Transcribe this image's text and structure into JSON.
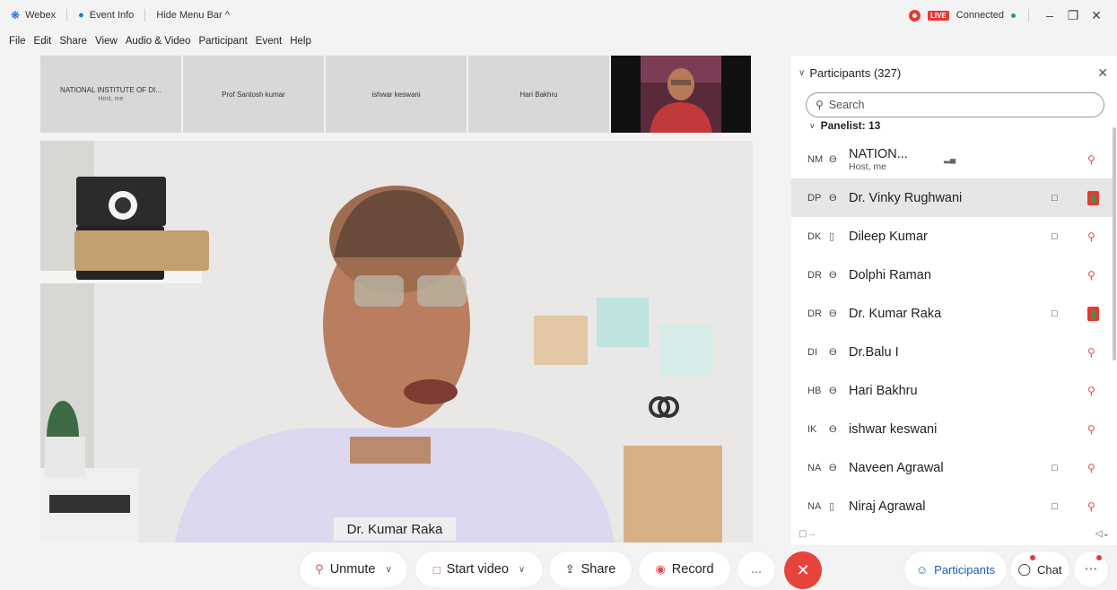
{
  "titlebar": {
    "app": "Webex",
    "event_info": "Event Info",
    "hide_menu": "Hide Menu Bar ^",
    "live": "LIVE",
    "connected": "Connected"
  },
  "menu": [
    "File",
    "Edit",
    "Share",
    "View",
    "Audio & Video",
    "Participant",
    "Event",
    "Help"
  ],
  "thumbnails": [
    {
      "name": "NATIONAL INSTITUTE OF DI...",
      "sub": "Host, me"
    },
    {
      "name": "Prof Santosh kumar",
      "sub": ""
    },
    {
      "name": "ishwar keswani",
      "sub": ""
    },
    {
      "name": "Hari Bakhru",
      "sub": ""
    }
  ],
  "main_video": {
    "speaker": "Dr. Kumar Raka"
  },
  "panel": {
    "title": "Participants (327)",
    "search_placeholder": "Search",
    "group": "Panelist: 13",
    "participants": [
      {
        "initials": "NM",
        "name": "NATION...",
        "sub": "Host, me",
        "audio": "computer",
        "cam": false,
        "mic": "muted"
      },
      {
        "initials": "DP",
        "name": "Dr. Vinky Rughwani",
        "sub": "",
        "audio": "computer",
        "cam": true,
        "mic": "live"
      },
      {
        "initials": "DK",
        "name": "Dileep Kumar",
        "sub": "",
        "audio": "phone",
        "cam": true,
        "mic": "muted"
      },
      {
        "initials": "DR",
        "name": "Dolphi Raman",
        "sub": "",
        "audio": "computer",
        "cam": false,
        "mic": "muted"
      },
      {
        "initials": "DR",
        "name": "Dr. Kumar Raka",
        "sub": "",
        "audio": "computer",
        "cam": true,
        "mic": "live"
      },
      {
        "initials": "DI",
        "name": "Dr.Balu I",
        "sub": "",
        "audio": "computer",
        "cam": false,
        "mic": "muted"
      },
      {
        "initials": "HB",
        "name": "Hari Bakhru",
        "sub": "",
        "audio": "computer",
        "cam": false,
        "mic": "muted"
      },
      {
        "initials": "IK",
        "name": "ishwar keswani",
        "sub": "",
        "audio": "computer",
        "cam": false,
        "mic": "muted"
      },
      {
        "initials": "NA",
        "name": "Naveen Agrawal",
        "sub": "",
        "audio": "computer",
        "cam": true,
        "mic": "muted"
      },
      {
        "initials": "NA",
        "name": "Niraj Agrawal",
        "sub": "",
        "audio": "phone",
        "cam": true,
        "mic": "muted"
      }
    ]
  },
  "controls": {
    "unmute": "Unmute",
    "start_video": "Start video",
    "share": "Share",
    "record": "Record",
    "more": "...",
    "participants": "Participants",
    "chat": "Chat"
  }
}
